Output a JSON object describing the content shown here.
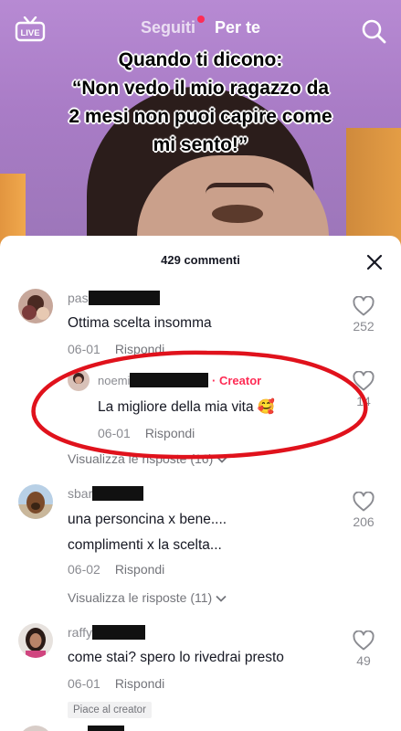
{
  "nav": {
    "live_label": "LIVE",
    "tab_following": "Seguiti",
    "tab_foryou": "Per te"
  },
  "video": {
    "caption_line1": "Quando ti dicono:",
    "caption_line2": "“Non vedo il mio ragazzo da",
    "caption_line3": "2 mesi non puoi capire come",
    "caption_line4": "mi sento!”"
  },
  "comments_sheet": {
    "title": "429 commenti",
    "comments": [
      {
        "username_visible": "pas",
        "text": "Ottima scelta insomma",
        "date": "06-01",
        "reply_label": "Rispondi",
        "likes": "252"
      },
      {
        "username_visible": "noemi",
        "creator_tag": "· Creator",
        "text": "La migliore della mia vita 🥰",
        "date": "06-01",
        "reply_label": "Rispondi",
        "likes": "14",
        "view_replies": "Visualizza le risposte (16)"
      },
      {
        "username_visible": "sbar",
        "text_line1": "una personcina x bene....",
        "text_line2": "complimenti x la scelta...",
        "date": "06-02",
        "reply_label": "Rispondi",
        "likes": "206",
        "view_replies": "Visualizza le risposte (11)"
      },
      {
        "username_visible": "raffy",
        "text": "come stai? spero lo rivedrai presto",
        "date": "06-01",
        "reply_label": "Rispondi",
        "likes": "49",
        "creator_like": "Piace al creator"
      }
    ]
  },
  "colors": {
    "accent": "#fe2c55",
    "annotation_red": "#e0121c"
  },
  "icons": [
    "live-icon",
    "search-icon",
    "close-icon",
    "heart-icon",
    "chevron-down-icon"
  ]
}
